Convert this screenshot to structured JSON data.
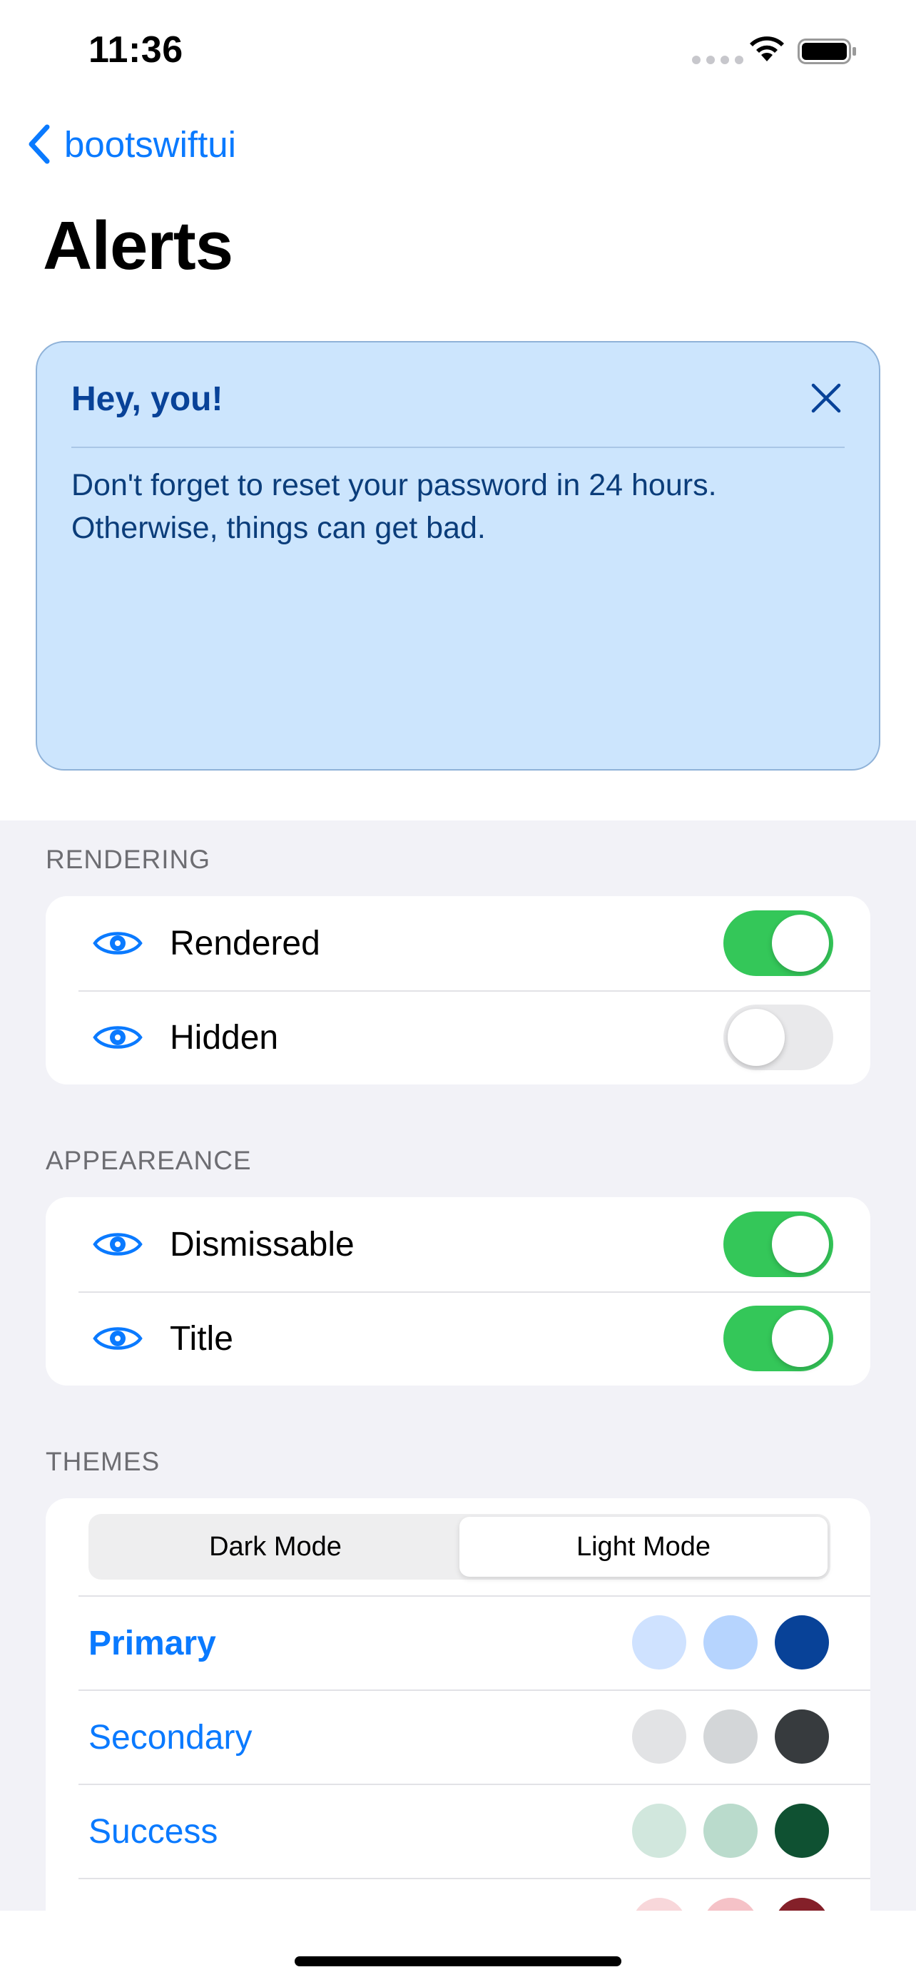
{
  "status_bar": {
    "time": "11:36"
  },
  "nav": {
    "back_label": "bootswiftui",
    "title": "Alerts"
  },
  "alert": {
    "title": "Hey, you!",
    "body": "Don't forget to reset your password in 24 hours. Otherwise, things can get bad.",
    "background": "#cce5fd",
    "text_color": "#084298"
  },
  "sections": {
    "rendering": {
      "header": "RENDERING",
      "rows": [
        {
          "label": "Rendered",
          "icon": "eye-icon",
          "on": true
        },
        {
          "label": "Hidden",
          "icon": "eye-icon",
          "on": false
        }
      ]
    },
    "appearance": {
      "header": "APPEAREANCE",
      "rows": [
        {
          "label": "Dismissable",
          "icon": "eye-icon",
          "on": true
        },
        {
          "label": "Title",
          "icon": "eye-icon",
          "on": true
        }
      ]
    },
    "themes": {
      "header": "THEMES",
      "segments": [
        "Dark Mode",
        "Light Mode"
      ],
      "selected_segment": "Light Mode",
      "items": [
        {
          "label": "Primary",
          "selected": true,
          "colors": [
            "#cfe2ff",
            "#b6d4fe",
            "#084298"
          ]
        },
        {
          "label": "Secondary",
          "selected": false,
          "colors": [
            "#e2e3e5",
            "#d3d6d8",
            "#373b3e"
          ]
        },
        {
          "label": "Success",
          "selected": false,
          "colors": [
            "#d1e7dd",
            "#badbcc",
            "#0f5132"
          ]
        },
        {
          "label": "",
          "selected": false,
          "colors": [
            "#f8d7da",
            "#f5c2c7",
            "#842029"
          ]
        }
      ]
    }
  },
  "colors": {
    "accent": "#0a7aff",
    "toggle_on": "#34c759",
    "toggle_off": "#e9e9eb",
    "grouped_bg": "#f2f2f7"
  }
}
